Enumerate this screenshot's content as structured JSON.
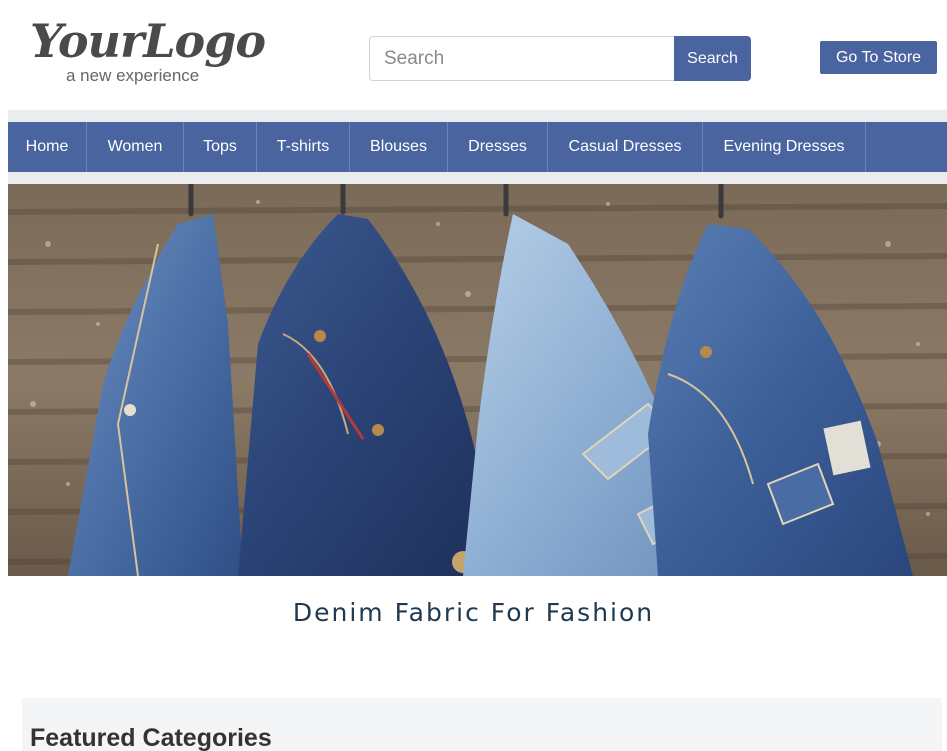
{
  "logo": {
    "main": "YourLogo",
    "tagline": "a new experience"
  },
  "search": {
    "placeholder": "Search",
    "value": "",
    "button_label": "Search"
  },
  "store_button": "Go To Store",
  "nav": {
    "items": [
      {
        "label": "Home"
      },
      {
        "label": "Women"
      },
      {
        "label": "Tops"
      },
      {
        "label": "T-shirts"
      },
      {
        "label": "Blouses"
      },
      {
        "label": "Dresses"
      },
      {
        "label": "Casual Dresses"
      },
      {
        "label": "Evening Dresses"
      }
    ]
  },
  "hero": {
    "tagline": "Denim Fabric For Fashion"
  },
  "featured": {
    "title": "Featured Categories"
  },
  "colors": {
    "accent": "#4a64a0",
    "nav_band": "#ebeced",
    "tagline": "#1f3a50",
    "featured_bg": "#f4f5f7"
  }
}
